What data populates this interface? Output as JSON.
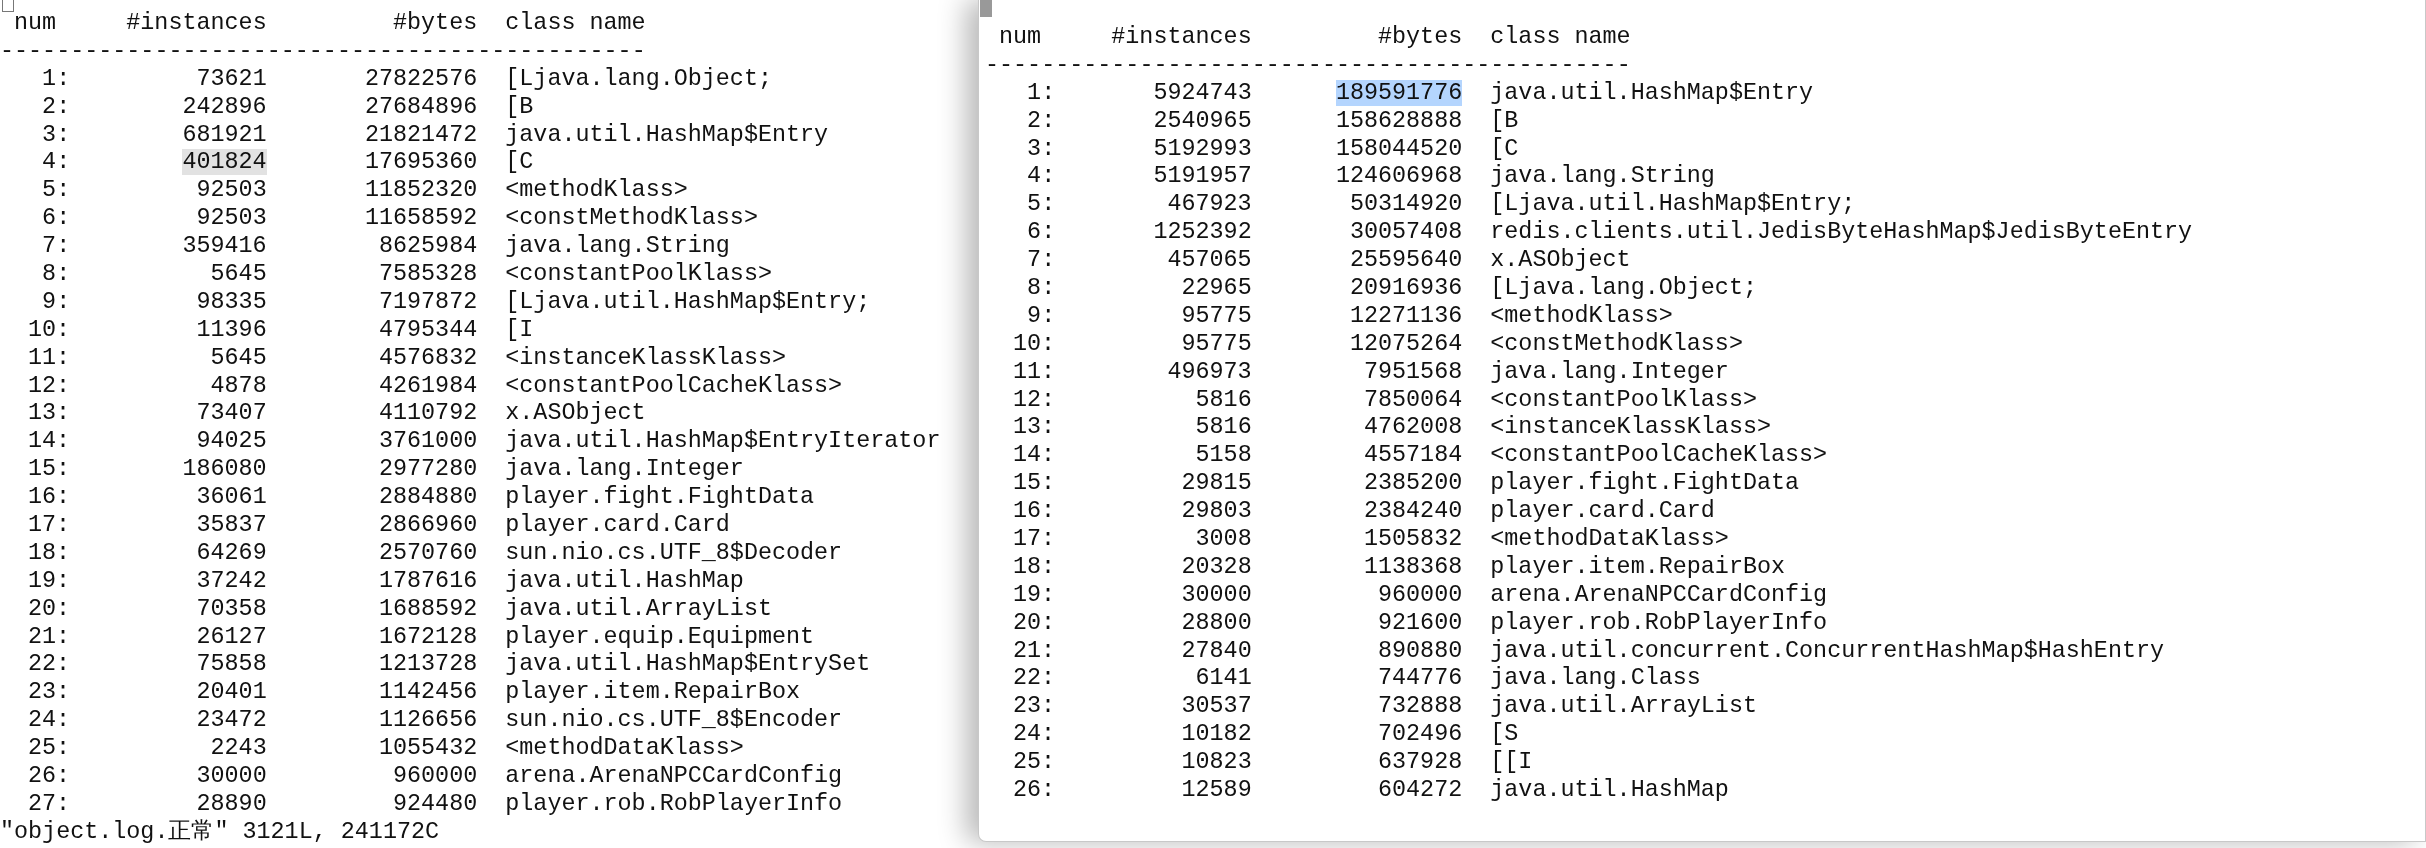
{
  "panes": [
    {
      "active": false,
      "columns": [
        "num",
        "#instances",
        "#bytes",
        "class name"
      ],
      "rule": "----------------------------------------------",
      "rows": [
        {
          "num": "1:",
          "instances": "73621",
          "bytes": "27822576",
          "class_name": "[Ljava.lang.Object;",
          "instances_selected": false,
          "bytes_selected": false
        },
        {
          "num": "2:",
          "instances": "242896",
          "bytes": "27684896",
          "class_name": "[B",
          "instances_selected": false,
          "bytes_selected": false
        },
        {
          "num": "3:",
          "instances": "681921",
          "bytes": "21821472",
          "class_name": "java.util.HashMap$Entry",
          "instances_selected": false,
          "bytes_selected": false
        },
        {
          "num": "4:",
          "instances": "401824",
          "bytes": "17695360",
          "class_name": "[C",
          "instances_selected": true,
          "bytes_selected": false
        },
        {
          "num": "5:",
          "instances": "92503",
          "bytes": "11852320",
          "class_name": "<methodKlass>",
          "instances_selected": false,
          "bytes_selected": false
        },
        {
          "num": "6:",
          "instances": "92503",
          "bytes": "11658592",
          "class_name": "<constMethodKlass>",
          "instances_selected": false,
          "bytes_selected": false
        },
        {
          "num": "7:",
          "instances": "359416",
          "bytes": "8625984",
          "class_name": "java.lang.String",
          "instances_selected": false,
          "bytes_selected": false
        },
        {
          "num": "8:",
          "instances": "5645",
          "bytes": "7585328",
          "class_name": "<constantPoolKlass>",
          "instances_selected": false,
          "bytes_selected": false
        },
        {
          "num": "9:",
          "instances": "98335",
          "bytes": "7197872",
          "class_name": "[Ljava.util.HashMap$Entry;",
          "instances_selected": false,
          "bytes_selected": false
        },
        {
          "num": "10:",
          "instances": "11396",
          "bytes": "4795344",
          "class_name": "[I",
          "instances_selected": false,
          "bytes_selected": false
        },
        {
          "num": "11:",
          "instances": "5645",
          "bytes": "4576832",
          "class_name": "<instanceKlassKlass>",
          "instances_selected": false,
          "bytes_selected": false
        },
        {
          "num": "12:",
          "instances": "4878",
          "bytes": "4261984",
          "class_name": "<constantPoolCacheKlass>",
          "instances_selected": false,
          "bytes_selected": false
        },
        {
          "num": "13:",
          "instances": "73407",
          "bytes": "4110792",
          "class_name": "x.ASObject",
          "instances_selected": false,
          "bytes_selected": false
        },
        {
          "num": "14:",
          "instances": "94025",
          "bytes": "3761000",
          "class_name": "java.util.HashMap$EntryIterator",
          "instances_selected": false,
          "bytes_selected": false
        },
        {
          "num": "15:",
          "instances": "186080",
          "bytes": "2977280",
          "class_name": "java.lang.Integer",
          "instances_selected": false,
          "bytes_selected": false
        },
        {
          "num": "16:",
          "instances": "36061",
          "bytes": "2884880",
          "class_name": "player.fight.FightData",
          "instances_selected": false,
          "bytes_selected": false
        },
        {
          "num": "17:",
          "instances": "35837",
          "bytes": "2866960",
          "class_name": "player.card.Card",
          "instances_selected": false,
          "bytes_selected": false
        },
        {
          "num": "18:",
          "instances": "64269",
          "bytes": "2570760",
          "class_name": "sun.nio.cs.UTF_8$Decoder",
          "instances_selected": false,
          "bytes_selected": false
        },
        {
          "num": "19:",
          "instances": "37242",
          "bytes": "1787616",
          "class_name": "java.util.HashMap",
          "instances_selected": false,
          "bytes_selected": false
        },
        {
          "num": "20:",
          "instances": "70358",
          "bytes": "1688592",
          "class_name": "java.util.ArrayList",
          "instances_selected": false,
          "bytes_selected": false
        },
        {
          "num": "21:",
          "instances": "26127",
          "bytes": "1672128",
          "class_name": "player.equip.Equipment",
          "instances_selected": false,
          "bytes_selected": false
        },
        {
          "num": "22:",
          "instances": "75858",
          "bytes": "1213728",
          "class_name": "java.util.HashMap$EntrySet",
          "instances_selected": false,
          "bytes_selected": false
        },
        {
          "num": "23:",
          "instances": "20401",
          "bytes": "1142456",
          "class_name": "player.item.RepairBox",
          "instances_selected": false,
          "bytes_selected": false
        },
        {
          "num": "24:",
          "instances": "23472",
          "bytes": "1126656",
          "class_name": "sun.nio.cs.UTF_8$Encoder",
          "instances_selected": false,
          "bytes_selected": false
        },
        {
          "num": "25:",
          "instances": "2243",
          "bytes": "1055432",
          "class_name": "<methodDataKlass>",
          "instances_selected": false,
          "bytes_selected": false
        },
        {
          "num": "26:",
          "instances": "30000",
          "bytes": "960000",
          "class_name": "arena.ArenaNPCCardConfig",
          "instances_selected": false,
          "bytes_selected": false
        },
        {
          "num": "27:",
          "instances": "28890",
          "bytes": "924480",
          "class_name": "player.rob.RobPlayerInfo",
          "instances_selected": false,
          "bytes_selected": false
        }
      ],
      "status_line": "\"object.log.正常\" 3121L, 241172C"
    },
    {
      "active": true,
      "columns": [
        "num",
        "#instances",
        "#bytes",
        "class name"
      ],
      "rule": "----------------------------------------------",
      "rows": [
        {
          "num": "1:",
          "instances": "5924743",
          "bytes": "189591776",
          "class_name": "java.util.HashMap$Entry",
          "instances_selected": false,
          "bytes_selected": true
        },
        {
          "num": "2:",
          "instances": "2540965",
          "bytes": "158628888",
          "class_name": "[B",
          "instances_selected": false,
          "bytes_selected": false
        },
        {
          "num": "3:",
          "instances": "5192993",
          "bytes": "158044520",
          "class_name": "[C",
          "instances_selected": false,
          "bytes_selected": false
        },
        {
          "num": "4:",
          "instances": "5191957",
          "bytes": "124606968",
          "class_name": "java.lang.String",
          "instances_selected": false,
          "bytes_selected": false
        },
        {
          "num": "5:",
          "instances": "467923",
          "bytes": "50314920",
          "class_name": "[Ljava.util.HashMap$Entry;",
          "instances_selected": false,
          "bytes_selected": false
        },
        {
          "num": "6:",
          "instances": "1252392",
          "bytes": "30057408",
          "class_name": "redis.clients.util.JedisByteHashMap$JedisByteEntry",
          "instances_selected": false,
          "bytes_selected": false
        },
        {
          "num": "7:",
          "instances": "457065",
          "bytes": "25595640",
          "class_name": "x.ASObject",
          "instances_selected": false,
          "bytes_selected": false
        },
        {
          "num": "8:",
          "instances": "22965",
          "bytes": "20916936",
          "class_name": "[Ljava.lang.Object;",
          "instances_selected": false,
          "bytes_selected": false
        },
        {
          "num": "9:",
          "instances": "95775",
          "bytes": "12271136",
          "class_name": "<methodKlass>",
          "instances_selected": false,
          "bytes_selected": false
        },
        {
          "num": "10:",
          "instances": "95775",
          "bytes": "12075264",
          "class_name": "<constMethodKlass>",
          "instances_selected": false,
          "bytes_selected": false
        },
        {
          "num": "11:",
          "instances": "496973",
          "bytes": "7951568",
          "class_name": "java.lang.Integer",
          "instances_selected": false,
          "bytes_selected": false
        },
        {
          "num": "12:",
          "instances": "5816",
          "bytes": "7850064",
          "class_name": "<constantPoolKlass>",
          "instances_selected": false,
          "bytes_selected": false
        },
        {
          "num": "13:",
          "instances": "5816",
          "bytes": "4762008",
          "class_name": "<instanceKlassKlass>",
          "instances_selected": false,
          "bytes_selected": false
        },
        {
          "num": "14:",
          "instances": "5158",
          "bytes": "4557184",
          "class_name": "<constantPoolCacheKlass>",
          "instances_selected": false,
          "bytes_selected": false
        },
        {
          "num": "15:",
          "instances": "29815",
          "bytes": "2385200",
          "class_name": "player.fight.FightData",
          "instances_selected": false,
          "bytes_selected": false
        },
        {
          "num": "16:",
          "instances": "29803",
          "bytes": "2384240",
          "class_name": "player.card.Card",
          "instances_selected": false,
          "bytes_selected": false
        },
        {
          "num": "17:",
          "instances": "3008",
          "bytes": "1505832",
          "class_name": "<methodDataKlass>",
          "instances_selected": false,
          "bytes_selected": false
        },
        {
          "num": "18:",
          "instances": "20328",
          "bytes": "1138368",
          "class_name": "player.item.RepairBox",
          "instances_selected": false,
          "bytes_selected": false
        },
        {
          "num": "19:",
          "instances": "30000",
          "bytes": "960000",
          "class_name": "arena.ArenaNPCCardConfig",
          "instances_selected": false,
          "bytes_selected": false
        },
        {
          "num": "20:",
          "instances": "28800",
          "bytes": "921600",
          "class_name": "player.rob.RobPlayerInfo",
          "instances_selected": false,
          "bytes_selected": false
        },
        {
          "num": "21:",
          "instances": "27840",
          "bytes": "890880",
          "class_name": "java.util.concurrent.ConcurrentHashMap$HashEntry",
          "instances_selected": false,
          "bytes_selected": false
        },
        {
          "num": "22:",
          "instances": "6141",
          "bytes": "744776",
          "class_name": "java.lang.Class",
          "instances_selected": false,
          "bytes_selected": false
        },
        {
          "num": "23:",
          "instances": "30537",
          "bytes": "732888",
          "class_name": "java.util.ArrayList",
          "instances_selected": false,
          "bytes_selected": false
        },
        {
          "num": "24:",
          "instances": "10182",
          "bytes": "702496",
          "class_name": "[S",
          "instances_selected": false,
          "bytes_selected": false
        },
        {
          "num": "25:",
          "instances": "10823",
          "bytes": "637928",
          "class_name": "[[I",
          "instances_selected": false,
          "bytes_selected": false
        },
        {
          "num": "26:",
          "instances": "12589",
          "bytes": "604272",
          "class_name": "java.util.HashMap",
          "instances_selected": false,
          "bytes_selected": false
        }
      ]
    }
  ]
}
